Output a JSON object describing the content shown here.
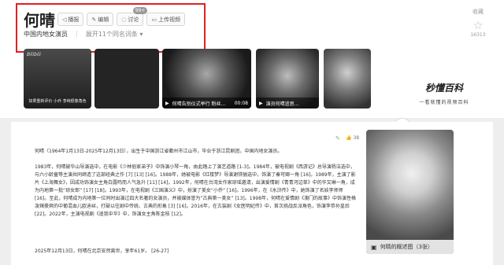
{
  "header": {
    "name": "何晴",
    "actions": [
      {
        "icon": "speaker-icon",
        "glyph": "◁",
        "label": "播报"
      },
      {
        "icon": "pencil-icon",
        "glyph": "✎",
        "label": "编辑"
      },
      {
        "icon": "speech-bubble-icon",
        "glyph": "◌",
        "label": "讨论",
        "badge": "99+"
      },
      {
        "icon": "video-icon",
        "glyph": "▭",
        "label": "上传视频"
      }
    ],
    "subtitle": "中国内地女演员",
    "more_entries": "展开11个同名词条 ▾",
    "collect_label": "收藏",
    "collect_count": "16313"
  },
  "media": {
    "tile1_brand": "Bilibili",
    "tile1_caption": "如果重新评价 小乔 李纯很像角色",
    "tile2_title": "何晴告别仪式举行 粉丝…",
    "tile2_duration": "00:08",
    "tile3_title": "演员何晴追思…",
    "logo_line1": "秒懂百科",
    "logo_line2": "一看就懂的视频百科"
  },
  "content": {
    "like_count": "38",
    "para1": "何晴（1964年1月13日-2025年12月13日），出生于中国浙江省衢州市江山市，毕业于浙江昆剧团，中国内地女演员。",
    "para2": "1983年，何晴被华山导演选中，在电影《少林俗家弟子》中饰演小琴一角，由此踏上了演艺道路 [1-3]。1984年，被电视剧《西游记》总导演杨洁选中，与六小龄童等主演共同缔造了这部经典之作 [7] [13] [16]。1988年，她被电影《红楼梦》导演谢铁骊选中，饰演了秦可卿一角 [16]。1989年，主演了影片《上海舞女》，因成功饰演女主角白露鸣而人气急升 [11] [14]。1992年，何晴在台湾女作家琼瑶邀请，出演爱情剧《青青河边草》中的华又琳一角，成为内地第一批“琼女郎” [17] [18]。1993年，在电视剧《三国演义》中，扮演了美女“小乔” [16]。1996年，在《水浒传》中，她饰演了名妓李师师 [16]。至此，何晴成为内地第一位同时出演过四大名著的女演员，并被媒体誉为“古典第一美女” [13]。1998年，何晴在爱情剧《澳门的故事》中饰演性格泼辣豪爽的中葡混血儿欧迪丝，打破以往剧中传统、古典的形象 [3] [16]。2016年，在古装剧《女医明妃传》中，首次挑战反派角色，饰演李恭孙皇后 [22]。2022年，主演电视剧《遥我中华》中，饰演女主角陈金枝 [12]。",
    "para3": "2025年12月13日，何晴在北京安然离世，享年61岁。 [26-27]",
    "photo_caption": "何晴的概述图（3张）"
  }
}
